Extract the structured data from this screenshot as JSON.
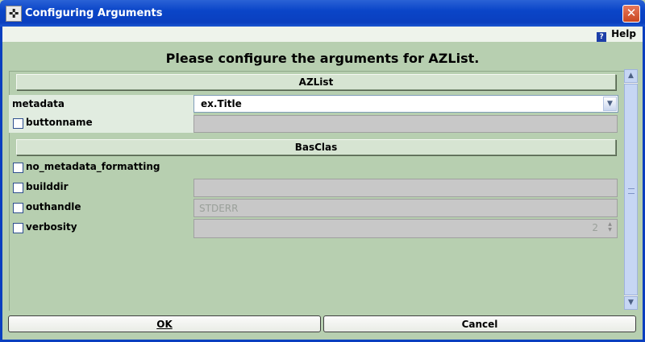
{
  "window": {
    "title": "Configuring Arguments",
    "close_symbol": "✕",
    "app_icon": "✜"
  },
  "menu": {
    "help_label": "Help",
    "help_icon_glyph": "?"
  },
  "heading": "Please configure the arguments for AZList.",
  "sections": {
    "azlist": "AZList",
    "basclas": "BasClas"
  },
  "args": {
    "metadata": {
      "label": "metadata",
      "value": "ex.Title"
    },
    "buttonname": {
      "label": "buttonname",
      "value": ""
    },
    "no_metadata_formatting": {
      "label": "no_metadata_formatting"
    },
    "builddir": {
      "label": "builddir",
      "value": ""
    },
    "outhandle": {
      "label": "outhandle",
      "value": "STDERR"
    },
    "verbosity": {
      "label": "verbosity",
      "value": "2"
    }
  },
  "buttons": {
    "ok": "OK",
    "cancel": "Cancel"
  }
}
